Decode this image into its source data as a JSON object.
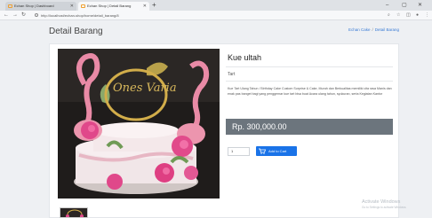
{
  "browser": {
    "tabs": [
      {
        "label": "Echan Shop | Dashboard"
      },
      {
        "label": "Echan Shop | Detail Barang"
      }
    ],
    "new_tab": "+",
    "url": "http://localhost/echan-shop/home/detail_barang/8"
  },
  "page": {
    "heading": "Detail Barang",
    "breadcrumb": [
      "Echan Cake",
      "Detail Barang"
    ]
  },
  "product": {
    "name": "Kue ultah",
    "category": "Tart",
    "description": "Kue Tart Ulang Tahun / Birthday Cake Custom Surprise & Cake, Murah dan Berkualitas memiliki cita rasa Manis dan enak pas banget bagi yang penggemar kue tart bisa buat Acara ulang tahun, syukuran, serta Kegiatan Kantor",
    "price": "Rp. 300,000.00",
    "quantity": "1",
    "add_to_cart": "Add to Cart",
    "topper_text": "Ones Varia"
  },
  "watermark": {
    "title": "Activate Windows",
    "subtitle": "Go to Settings to activate Windows."
  },
  "colors": {
    "link": "#3a7bd5",
    "price_bg": "#6c757d",
    "button": "#1a73e8"
  }
}
